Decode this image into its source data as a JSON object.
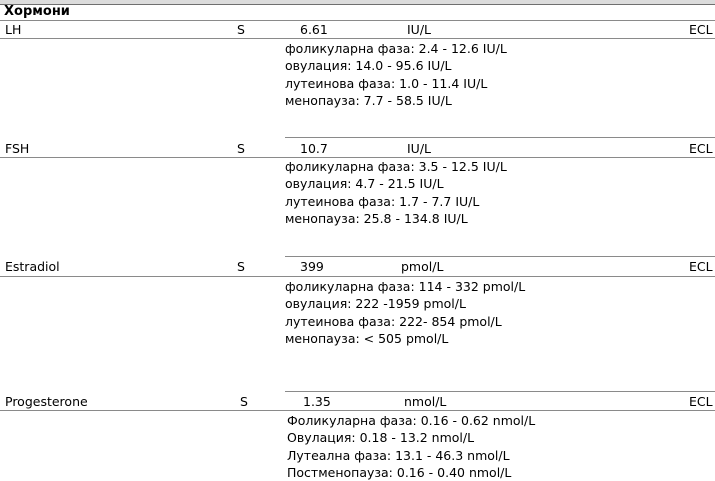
{
  "section_title": "Хормони",
  "tests": [
    {
      "name": "LH",
      "sample": "S",
      "value": "6.61",
      "unit": "IU/L",
      "method": "ECL",
      "reference": [
        "фоликуларна фаза: 2.4 - 12.6 IU/L",
        "овулация: 14.0 - 95.6 IU/L",
        "лутеинова фаза: 1.0 - 11.4 IU/L",
        "менопауза: 7.7 - 58.5 IU/L"
      ]
    },
    {
      "name": "FSH",
      "sample": "S",
      "value": "10.7",
      "unit": "IU/L",
      "method": "ECL",
      "reference": [
        "фоликуларна фаза: 3.5 - 12.5 IU/L",
        "овулация: 4.7 - 21.5 IU/L",
        "лутеинова фаза: 1.7 - 7.7 IU/L",
        "менопауза: 25.8 - 134.8 IU/L"
      ]
    },
    {
      "name": "Estradiol",
      "sample": "S",
      "value": "399",
      "unit": "pmol/L",
      "method": "ECL",
      "reference": [
        "фоликуларна фаза: 114 - 332 pmol/L",
        "овулация: 222 -1959 pmol/L",
        "лутеинова фаза: 222- 854 pmol/L",
        "менопауза: < 505 pmol/L"
      ]
    },
    {
      "name": "Progesterone",
      "sample": "S",
      "value": "1.35",
      "unit": "nmol/L",
      "method": "ECL",
      "reference": [
        "Фоликуларна фаза: 0.16 - 0.62 nmol/L",
        "Овулация: 0.18 - 13.2 nmol/L",
        "Лутеална фаза: 13.1 - 46.3 nmol/L",
        "Постменопауза: 0.16 - 0.40 nmol/L"
      ]
    }
  ]
}
